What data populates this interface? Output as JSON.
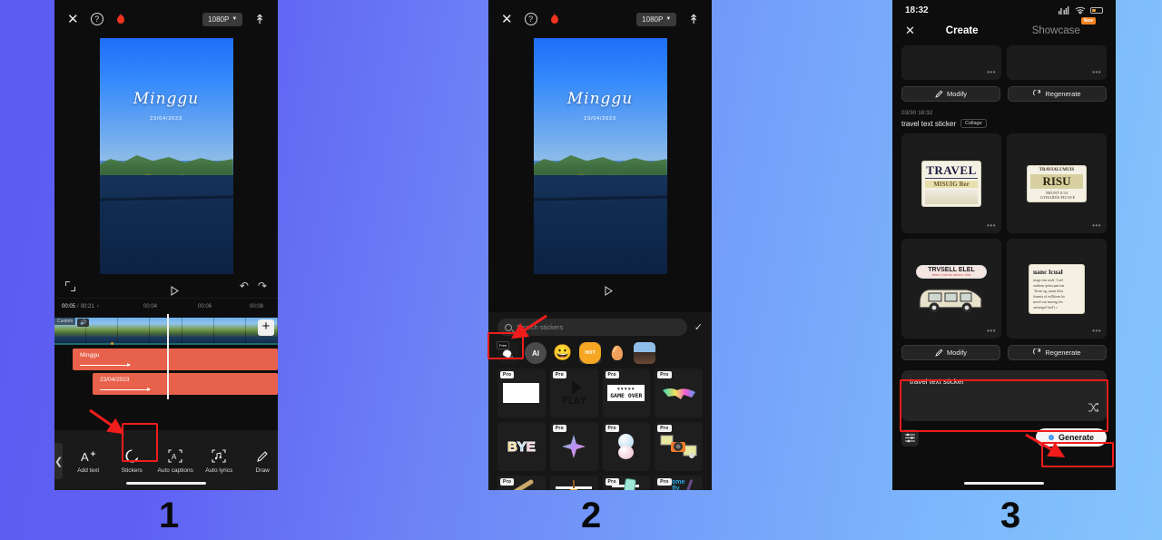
{
  "background": {
    "from": "#5b5bf2",
    "to": "#86c4fd"
  },
  "steps": [
    {
      "number": "1"
    },
    {
      "number": "2"
    },
    {
      "number": "3"
    }
  ],
  "panel1": {
    "header": {
      "close_icon": "close-icon",
      "help_icon": "help-circle-icon",
      "flame_icon": "flame-icon",
      "resolution": "1080P",
      "export_icon": "upload-icon"
    },
    "preview": {
      "title": "Minggu",
      "date": "23/04/2023"
    },
    "transport": {
      "expand_icon": "fullscreen-icon",
      "play_icon": "play-icon",
      "undo_icon": "undo-icon",
      "redo_icon": "redo-icon"
    },
    "ruler": {
      "current": "00:05",
      "separator": "/",
      "total": "00:21",
      "ticks": [
        "00:04",
        "00:06",
        "00:08"
      ]
    },
    "timeline": {
      "custom_badge": "Custom",
      "add_label": "+",
      "clips": [
        {
          "label": "Minggu"
        },
        {
          "label": "23/04/2023"
        }
      ]
    },
    "toolbar": {
      "back_icon": "chevron-left-icon",
      "items": [
        {
          "label": "Add text",
          "icon": "text-plus-icon"
        },
        {
          "label": "Stickers",
          "icon": "sticker-icon"
        },
        {
          "label": "Auto captions",
          "icon": "auto-captions-icon"
        },
        {
          "label": "Auto lyrics",
          "icon": "auto-lyrics-icon"
        },
        {
          "label": "Draw",
          "icon": "pencil-icon"
        }
      ]
    }
  },
  "panel2": {
    "header": {
      "close_icon": "close-icon",
      "help_icon": "help-circle-icon",
      "flame_icon": "flame-icon",
      "resolution": "1080P",
      "export_icon": "upload-icon"
    },
    "preview": {
      "title": "Minggu",
      "date": "23/04/2023"
    },
    "sheet": {
      "search_placeholder": "Search stickers",
      "confirm_icon": "check-icon",
      "categories": [
        {
          "name": "ai-free-sticker",
          "badge": "Free",
          "label": "AI"
        },
        {
          "name": "ai-category",
          "label": "AI"
        },
        {
          "name": "emoji-category",
          "label": "😀"
        },
        {
          "name": "hot-category",
          "label": "HOT"
        },
        {
          "name": "egg-category",
          "label": "🥚"
        },
        {
          "name": "photo-category",
          "label": ""
        }
      ],
      "pro_label": "Pro",
      "stickers": [
        {
          "pro": true,
          "art": "blank-card"
        },
        {
          "pro": true,
          "art": "play"
        },
        {
          "pro": true,
          "art": "game-over"
        },
        {
          "pro": true,
          "art": "rainbow-glasses"
        },
        {
          "pro": false,
          "art": "bye"
        },
        {
          "pro": true,
          "art": "sparkle"
        },
        {
          "pro": true,
          "art": "bubbles"
        },
        {
          "pro": true,
          "art": "camera"
        },
        {
          "pro": true,
          "art": "stick"
        },
        {
          "pro": false,
          "art": "lamp"
        },
        {
          "pro": true,
          "art": "phone"
        },
        {
          "pro": true,
          "art": "come-fly"
        }
      ]
    }
  },
  "panel3": {
    "status": {
      "time": "18:32",
      "signal_icon": "signal-icon",
      "wifi_icon": "wifi-icon",
      "battery_icon": "battery-icon"
    },
    "tabs": {
      "close_icon": "close-icon",
      "items": [
        {
          "label": "Create",
          "active": true,
          "badge": ""
        },
        {
          "label": "Showcase",
          "active": false,
          "badge": "New"
        }
      ]
    },
    "top_results": {
      "dots": "•••"
    },
    "actions_top": [
      {
        "label": "Modify",
        "icon": "pencil-icon"
      },
      {
        "label": "Regenerate",
        "icon": "refresh-icon"
      }
    ],
    "history": {
      "timestamp": "03/30 18:32",
      "prompt": "travel text sticker",
      "tag": "Collage"
    },
    "results": [
      {
        "art": "travel-card",
        "line1": "TRAVEL",
        "line2": "MISUIG Rer",
        "dots": "•••"
      },
      {
        "art": "risu-card",
        "line1": "TRAVIALI MUIS",
        "line2": "RISU",
        "dots": "•••"
      },
      {
        "art": "van-sticker",
        "line1": "TRVSELL ELEL",
        "line2": "",
        "dots": "•••"
      },
      {
        "art": "note-card",
        "line1": "uanc lcual",
        "line2": "",
        "dots": "•••"
      }
    ],
    "actions_bottom": [
      {
        "label": "Modify",
        "icon": "pencil-icon"
      },
      {
        "label": "Regenerate",
        "icon": "refresh-icon"
      }
    ],
    "prompt_box": {
      "value": "travel text sticker",
      "shuffle_icon": "shuffle-icon"
    },
    "generate": {
      "settings_icon": "sliders-icon",
      "label": "Generate"
    }
  }
}
